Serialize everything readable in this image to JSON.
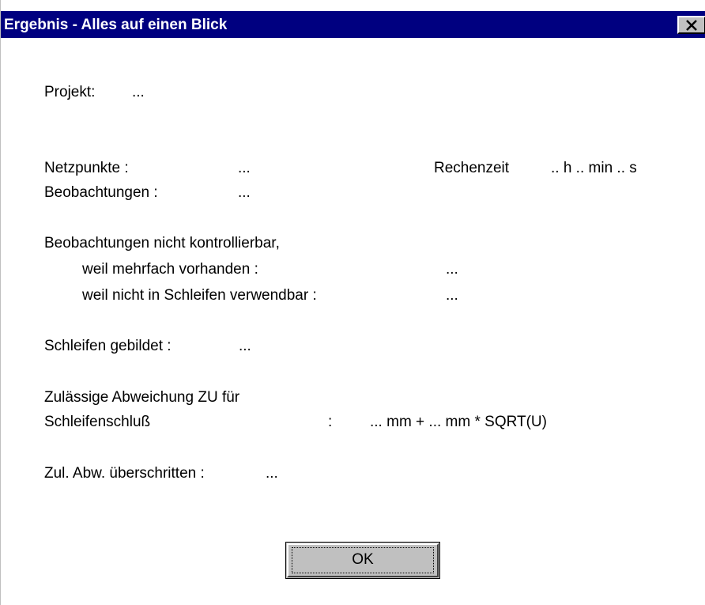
{
  "window": {
    "title": "Ergebnis - Alles auf einen Blick",
    "close_icon": "close-icon"
  },
  "project": {
    "label": "Projekt:",
    "value": "..."
  },
  "stats": {
    "netzpunkte_label": "Netzpunkte :",
    "netzpunkte_value": "...",
    "rechenzeit_label": "Rechenzeit",
    "rechenzeit_value": ".. h .. min .. s",
    "beobachtungen_label": "Beobachtungen :",
    "beobachtungen_value": "..."
  },
  "not_controllable": {
    "heading": "Beobachtungen nicht kontrollierbar,",
    "mehrfach_label": "weil mehrfach vorhanden :",
    "mehrfach_value": "...",
    "schleifen_label": "weil nicht in Schleifen verwendbar :",
    "schleifen_value": "..."
  },
  "loops": {
    "label": "Schleifen gebildet :",
    "value": "..."
  },
  "tolerance": {
    "line1": "Zulässige Abweichung ZU für",
    "line2_label": "Schleifenschluß",
    "colon": ":",
    "formula": "... mm + ... mm * SQRT(U)"
  },
  "exceeded": {
    "label": "Zul. Abw. überschritten :",
    "value": "..."
  },
  "ok_button": {
    "label": "OK"
  }
}
